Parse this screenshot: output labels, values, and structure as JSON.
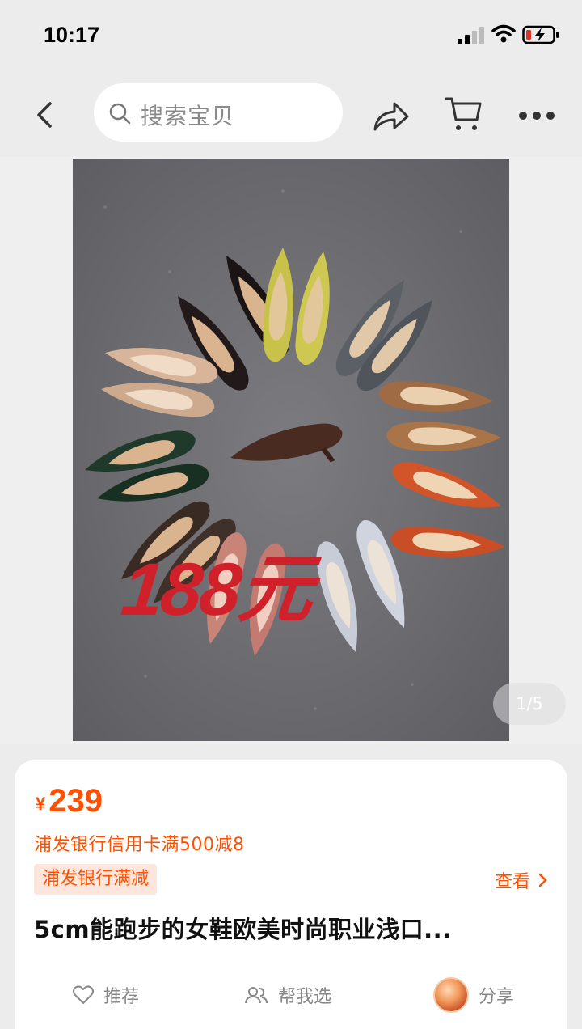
{
  "status_bar": {
    "time": "10:17"
  },
  "nav": {
    "search_placeholder": "搜索宝贝"
  },
  "gallery": {
    "page_indicator": "1/5",
    "overlay_price": "188元"
  },
  "product": {
    "price_symbol": "¥",
    "price": "239",
    "promo_text": "浦发银行信用卡满500减8",
    "promo_tag": "浦发银行满减",
    "view_link": "查看",
    "title": "5cm能跑步的女鞋欧美时尚职业浅口..."
  },
  "actions": {
    "recommend": "推荐",
    "help_choose": "帮我选",
    "share": "分享"
  },
  "colors": {
    "accent": "#ff5000",
    "overlay_red": "#d0202a"
  }
}
